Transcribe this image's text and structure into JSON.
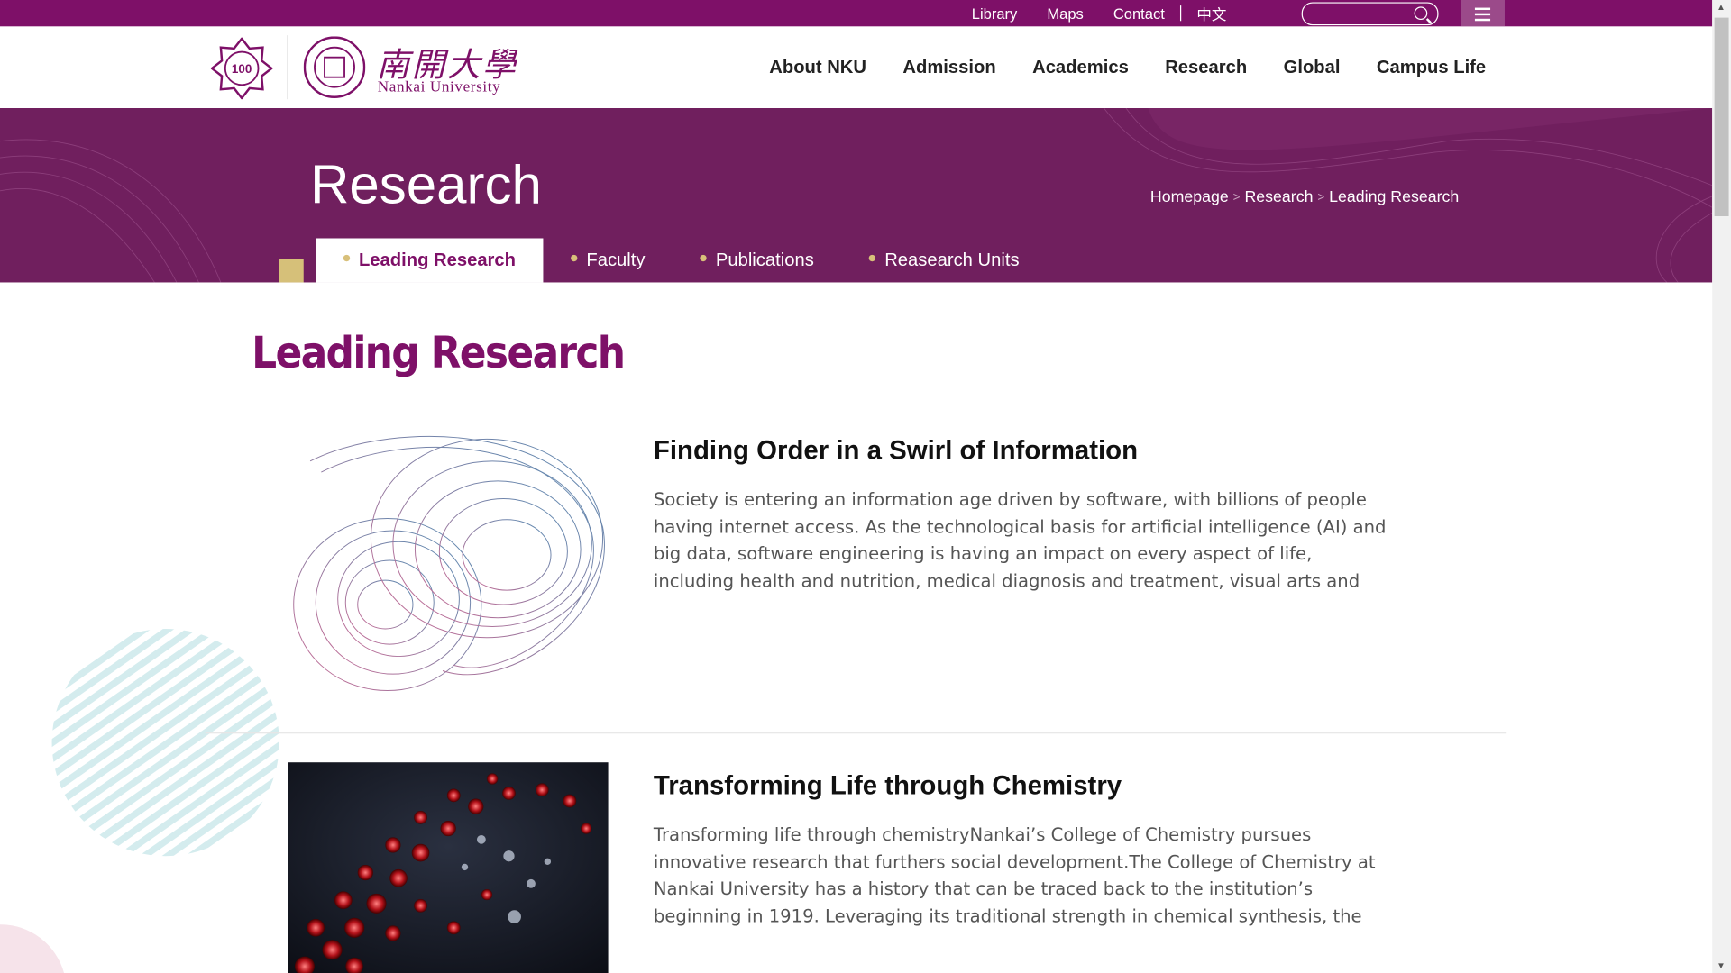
{
  "topbar": {
    "links": [
      "Library",
      "Maps",
      "Contact",
      "中文"
    ],
    "search_placeholder": ""
  },
  "header": {
    "logo_cn": "南開大學",
    "logo_en": "Nankai University",
    "logo_100": "100",
    "nav": [
      "About NKU",
      "Admission",
      "Academics",
      "Research",
      "Global",
      "Campus Life"
    ]
  },
  "banner": {
    "title": "Research",
    "breadcrumb": [
      "Homepage",
      "Research",
      "Leading Research"
    ],
    "tabs": [
      "Leading Research",
      "Faculty",
      "Publications",
      "Reasearch Units"
    ]
  },
  "main": {
    "heading": "Leading Research",
    "items": [
      {
        "title": "Finding Order in a Swirl of Information",
        "text": "Society is entering an information age driven by software, with billions of people having internet access. As the technological basis for artificial intelligence (AI) and big data, software engineering is having an impact on every aspect of life, including health and nutrition, medical diagnosis and treatment, visual arts and"
      },
      {
        "title": "Transforming Life through Chemistry",
        "text": "Transforming life through chemistryNankai’s College of Chemistry pursues innovative research that furthers social development.The College of Chemistry at Nankai University has a history that can be traced back to the institution’s beginning in 1919. Leveraging its traditional strength in chemical synthesis, the"
      }
    ]
  },
  "colors": {
    "brand": "#7e1068",
    "banner": "#701f5e",
    "gold": "#d6c079"
  }
}
